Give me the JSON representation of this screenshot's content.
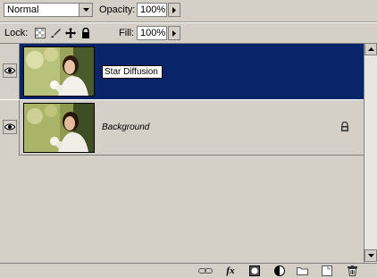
{
  "blend": {
    "mode": "Normal"
  },
  "opacity": {
    "label": "Opacity:",
    "value": "100%"
  },
  "lock": {
    "label": "Lock:"
  },
  "fill": {
    "label": "Fill:",
    "value": "100%"
  },
  "layers": [
    {
      "name": "Star Diffusion",
      "selected": true,
      "editing": true
    },
    {
      "name": "Background",
      "selected": false,
      "locked": true
    }
  ],
  "toolbar": {
    "icons": [
      "link-icon",
      "fx-icon",
      "mask-icon",
      "adjustment-icon",
      "folder-icon",
      "new-layer-icon",
      "trash-icon"
    ],
    "fx_label": "fx"
  },
  "colors": {
    "selection": "#0a246a",
    "panel": "#d4d0c8"
  }
}
